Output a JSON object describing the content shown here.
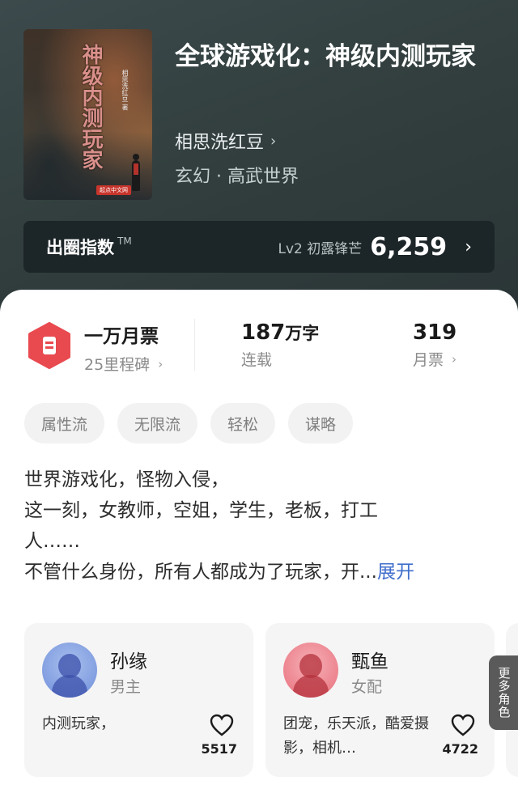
{
  "book": {
    "title": "全球游戏化：神级内测玩家",
    "author": "相思洗红豆",
    "genre": "玄幻 · 高武世界",
    "cover": {
      "title_text": "神级内测玩家",
      "author_text": "相思洗红豆 著",
      "publisher": "起点中文网"
    }
  },
  "index_bar": {
    "label": "出圈指数",
    "tm": "TM",
    "level": "Lv2 初露锋芒",
    "score": "6,259"
  },
  "stats": {
    "milestone_title": "一万月票",
    "milestone_sub": "25里程碑",
    "words_num": "187",
    "words_unit": "万字",
    "words_status": "连载",
    "tickets_num": "319",
    "tickets_label": "月票"
  },
  "tags": [
    "属性流",
    "无限流",
    "轻松",
    "谋略"
  ],
  "description": {
    "line1": "世界游戏化，怪物入侵，",
    "line2": "这一刻，女教师，空姐，学生，老板，打工",
    "line3": "人……",
    "line4": "不管什么身份，所有人都成为了玩家，开...",
    "expand": "展开"
  },
  "characters": [
    {
      "name": "孙缘",
      "role": "男主",
      "desc": "内测玩家，",
      "likes": "5517"
    },
    {
      "name": "甄鱼",
      "role": "女配",
      "desc": "团宠，乐天派，酷爱摄影，相机…",
      "likes": "4722"
    }
  ],
  "more_roles": "更多角色",
  "colors": {
    "accent_blue": "#3f6ecb",
    "badge_red": "#e84a4f",
    "hero_bg": "#33403f"
  }
}
